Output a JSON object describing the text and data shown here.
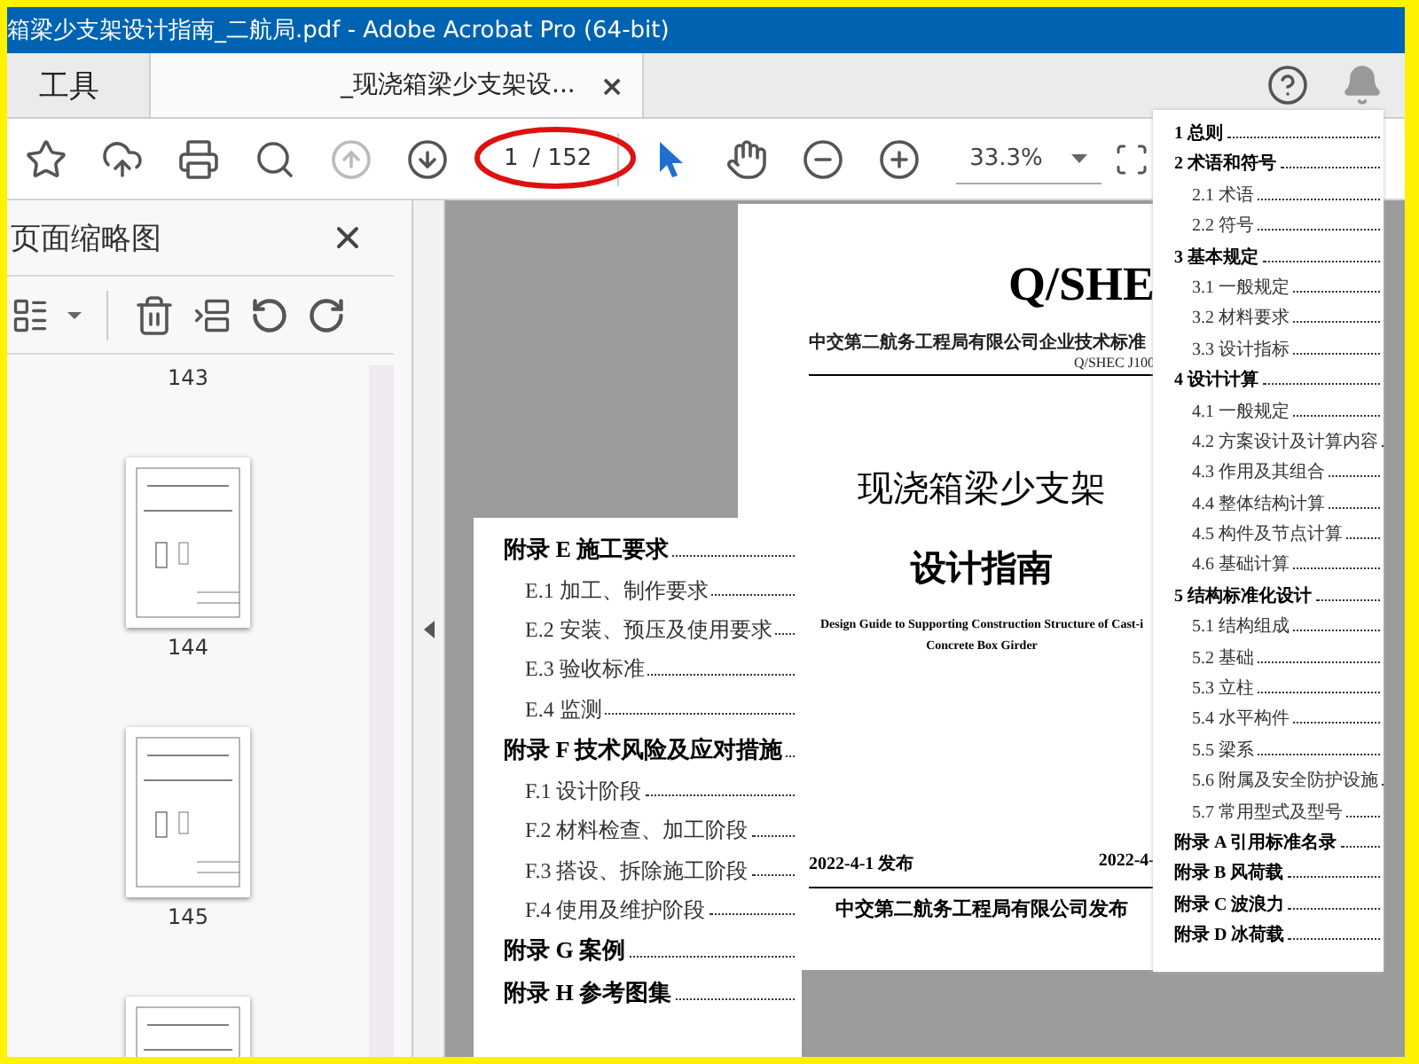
{
  "window": {
    "title": "箱梁少支架设计指南_二航局.pdf - Adobe Acrobat Pro (64-bit)"
  },
  "tabs": [
    {
      "label": "工具",
      "selected": false
    },
    {
      "label": "_现浇箱梁少支架设...",
      "selected": true,
      "close": "×"
    }
  ],
  "toolbar": {
    "page_current": "1",
    "page_total": "/ 152",
    "zoom": "33.3%"
  },
  "sidebar": {
    "title": "页面缩略图",
    "thumbnail_labels": [
      "143",
      "144",
      "145"
    ]
  },
  "cover": {
    "code": "Q/SHE",
    "header_left": "中交第二航务工程局有限公司企业技术标准",
    "header_right": "Q/SHEC J100",
    "title_lines": [
      "现浇箱梁少支架",
      "设计指南"
    ],
    "english_lines": [
      "Design Guide to Supporting Construction Structure of Cast-i",
      "Concrete Box Girder"
    ],
    "issue_date": "2022-4-1 发布",
    "effective_date": "2022-4-",
    "publisher": "中交第二航务工程局有限公司发布"
  },
  "toc_left": [
    {
      "kind": "appendix",
      "number": "附录 E",
      "title": "施工要求"
    },
    {
      "kind": "section",
      "number": "E.1",
      "title": "加工、制作要求"
    },
    {
      "kind": "section",
      "number": "E.2",
      "title": "安装、预压及使用要求"
    },
    {
      "kind": "section",
      "number": "E.3",
      "title": "验收标准"
    },
    {
      "kind": "section",
      "number": "E.4",
      "title": "监测"
    },
    {
      "kind": "appendix",
      "number": "附录 F",
      "title": "技术风险及应对措施"
    },
    {
      "kind": "section",
      "number": "F.1",
      "title": "设计阶段"
    },
    {
      "kind": "section",
      "number": "F.2",
      "title": "材料检查、加工阶段"
    },
    {
      "kind": "section",
      "number": "F.3",
      "title": "搭设、拆除施工阶段"
    },
    {
      "kind": "section",
      "number": "F.4",
      "title": "使用及维护阶段"
    },
    {
      "kind": "appendix",
      "number": "附录 G",
      "title": "案例"
    },
    {
      "kind": "appendix",
      "number": "附录 H",
      "title": "参考图集"
    }
  ],
  "toc_right": [
    {
      "kind": "chapter",
      "number": "1",
      "title": "总则"
    },
    {
      "kind": "chapter",
      "number": "2",
      "title": "术语和符号"
    },
    {
      "kind": "section",
      "number": "2.1",
      "title": "术语"
    },
    {
      "kind": "section",
      "number": "2.2",
      "title": "符号"
    },
    {
      "kind": "chapter",
      "number": "3",
      "title": "基本规定"
    },
    {
      "kind": "section",
      "number": "3.1",
      "title": "一般规定"
    },
    {
      "kind": "section",
      "number": "3.2",
      "title": "材料要求"
    },
    {
      "kind": "section",
      "number": "3.3",
      "title": "设计指标"
    },
    {
      "kind": "chapter",
      "number": "4",
      "title": "设计计算"
    },
    {
      "kind": "section",
      "number": "4.1",
      "title": "一般规定"
    },
    {
      "kind": "section",
      "number": "4.2",
      "title": "方案设计及计算内容"
    },
    {
      "kind": "section",
      "number": "4.3",
      "title": "作用及其组合"
    },
    {
      "kind": "section",
      "number": "4.4",
      "title": "整体结构计算"
    },
    {
      "kind": "section",
      "number": "4.5",
      "title": "构件及节点计算"
    },
    {
      "kind": "section",
      "number": "4.6",
      "title": "基础计算"
    },
    {
      "kind": "chapter",
      "number": "5",
      "title": "结构标准化设计"
    },
    {
      "kind": "section",
      "number": "5.1",
      "title": "结构组成"
    },
    {
      "kind": "section",
      "number": "5.2",
      "title": "基础"
    },
    {
      "kind": "section",
      "number": "5.3",
      "title": "立柱"
    },
    {
      "kind": "section",
      "number": "5.4",
      "title": "水平构件"
    },
    {
      "kind": "section",
      "number": "5.5",
      "title": "梁系"
    },
    {
      "kind": "section",
      "number": "5.6",
      "title": "附属及安全防护设施"
    },
    {
      "kind": "section",
      "number": "5.7",
      "title": "常用型式及型号"
    },
    {
      "kind": "appendix",
      "number": "附录 A",
      "title": "引用标准名录"
    },
    {
      "kind": "appendix",
      "number": "附录 B",
      "title": "风荷载"
    },
    {
      "kind": "appendix",
      "number": "附录 C",
      "title": "波浪力"
    },
    {
      "kind": "appendix",
      "number": "附录 D",
      "title": "冰荷载"
    }
  ]
}
